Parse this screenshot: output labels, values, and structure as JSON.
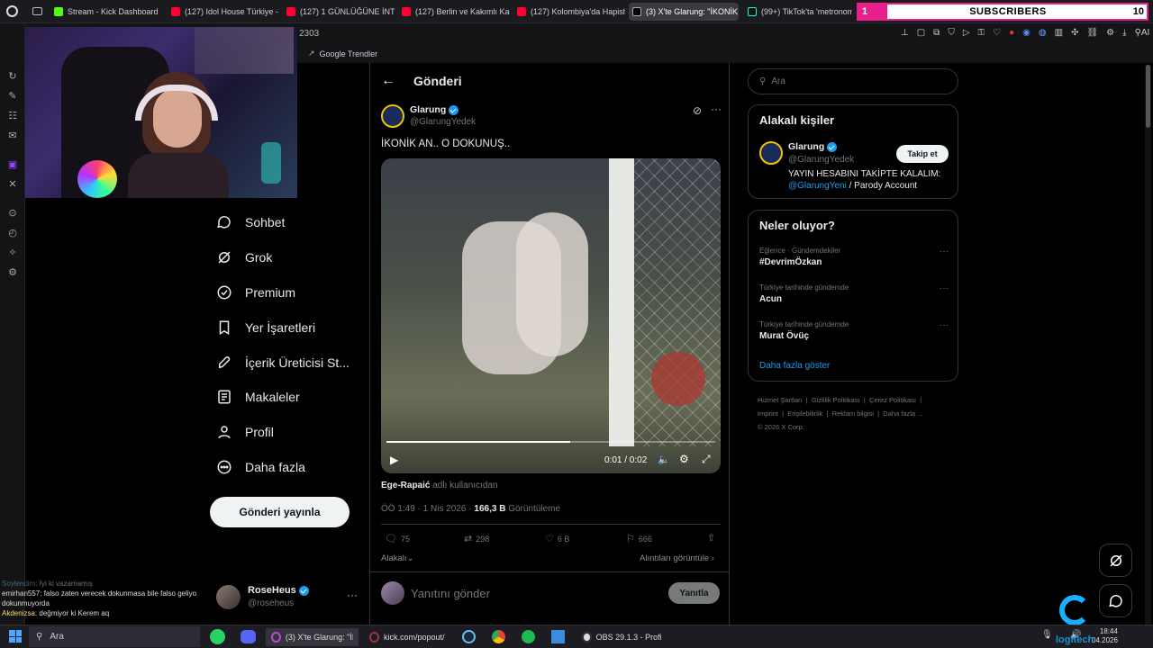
{
  "tabs": [
    {
      "label": "Stream - Kick Dashboard",
      "color": "#53fc18"
    },
    {
      "label": "(127) Idol House Türkiye -",
      "color": "#ff0033"
    },
    {
      "label": "(127) 1 GÜNLÜĞÜNE İNTE",
      "color": "#ff0033"
    },
    {
      "label": "(127) Berlin ve Kakımlı Kac",
      "color": "#ff0033"
    },
    {
      "label": "(127) Kolombiya'da Hapish",
      "color": "#ff0033"
    },
    {
      "label": "(3) X'te Glarung: \"İKONİK",
      "color": "#ffffff"
    },
    {
      "label": "(99+) TikTok'ta 'metronom",
      "color": "#ffffff"
    }
  ],
  "subscribers": {
    "count_left": "1",
    "label": "SUBSCRIBERS",
    "count_right": "10"
  },
  "toolbar": {
    "number": "2303",
    "ai_label": "AI"
  },
  "bookmark": {
    "label": "Google Trendler"
  },
  "nav": [
    {
      "label": "Sohbet",
      "icon": "chat-bubble-icon"
    },
    {
      "label": "Grok",
      "icon": "grok-icon"
    },
    {
      "label": "Premium",
      "icon": "premium-icon"
    },
    {
      "label": "Yer İşaretleri",
      "icon": "bookmark-icon"
    },
    {
      "label": "İçerik Üreticisi St...",
      "icon": "rocket-icon"
    },
    {
      "label": "Makaleler",
      "icon": "article-icon"
    },
    {
      "label": "Profil",
      "icon": "person-icon"
    },
    {
      "label": "Daha fazla",
      "icon": "more-circle-icon"
    }
  ],
  "post_button": "Gönderi yayınla",
  "account": {
    "name": "RoseHeus",
    "handle": "@roseheus"
  },
  "chat": [
    {
      "user": "Soylendim",
      "msg": ": İyi ki vazamamış"
    },
    {
      "user": "emirhan557",
      "msg": ": falso zaten verecek dokunmasa bile falso geliyo dokunmuyorda"
    },
    {
      "user": "Akdenizsa",
      "msg": ": değmiyor ki Kerem aq"
    }
  ],
  "main": {
    "header_title": "Gönderi",
    "author_name": "Glarung",
    "author_handle": "@GlarungYedek",
    "text": "İKONİK AN.. O DOKUNUŞ..",
    "video_time": "0:01 / 0:02",
    "video_progress": 0.56,
    "attribution_user": "Ege-Rapaić",
    "attribution_suffix": "adlı kullanıcıdan",
    "meta_time": "ÖÖ 1:49 · 1 Nis 2026 · ",
    "views": "166,3 B",
    "views_label": "Görüntüleme",
    "stats": {
      "replies": "75",
      "reposts": "298",
      "likes": "6 B",
      "bookmarks": "666"
    },
    "relevant": "Alakalı",
    "quotes": "Alıntıları görüntüle",
    "reply_placeholder": "Yanıtını gönder",
    "reply_button": "Yanıtla"
  },
  "right": {
    "search_placeholder": "Ara",
    "related_title": "Alakalı kişiler",
    "related_name": "Glarung",
    "related_handle": "@GlarungYedek",
    "follow_button": "Takip et",
    "bio_line1": "YAYIN HESABINI TAKİPTE KALALIM:",
    "bio_link": "@GlarungYeni",
    "bio_rest": " / Parody Account",
    "trending_title": "Neler oluyor?",
    "trends": [
      {
        "category": "Eğlence · Gündemdekiler",
        "name": "#DevrimÖzkan"
      },
      {
        "category": "Türkiye tarihinde gündemde",
        "name": "Acun"
      },
      {
        "category": "Türkiye tarihinde gündemde",
        "name": "Murat Övüç"
      }
    ],
    "show_more": "Daha fazla göster",
    "footer": [
      "Hizmet Şartları",
      "Gizlilik Politikası",
      "Çerez Politikası",
      "Imprint",
      "Erişilebilirlik",
      "Reklam bilgisi",
      "Daha fazla ...",
      "© 2026 X Corp."
    ]
  },
  "taskbar": {
    "search": "Ara",
    "apps": [
      "(3) X'te Glarung: \"İK...",
      "kick.com/popout/r...",
      "OBS 29.1.3 - Profil: ..."
    ],
    "time": "18:44",
    "date": "04.2026",
    "watermark": "logitech"
  }
}
